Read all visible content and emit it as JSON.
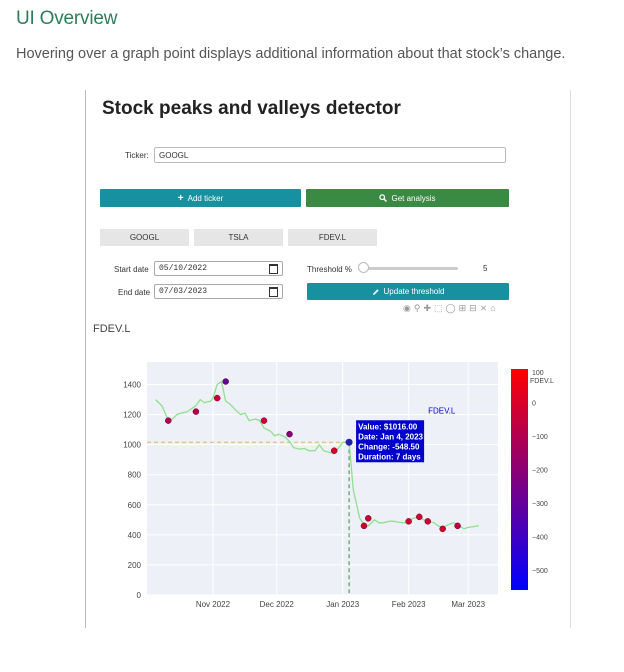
{
  "doc": {
    "title": "UI Overview",
    "description": "Hovering over a graph point displays additional information about that stock’s change."
  },
  "app": {
    "title": "Stock peaks and valleys detector",
    "ticker_label": "Ticker:",
    "ticker_value": "GOOGL",
    "add_ticker_label": "Add ticker",
    "get_analysis_label": "Get analysis",
    "tabs": [
      "GOOGL",
      "TSLA",
      "FDEV.L"
    ],
    "start_date_label": "Start date",
    "start_date_value": "05/10/2022",
    "end_date_label": "End date",
    "end_date_value": "07/03/2023",
    "threshold_label": "Threshold %",
    "threshold_value": "5",
    "threshold_fraction": 0.0,
    "update_threshold_label": "Update threshold",
    "icons": {
      "add": "plus-icon",
      "search": "search-icon",
      "pencil": "pencil-icon",
      "calendar": "calendar-icon",
      "modebar": [
        "camera-icon",
        "zoom-icon",
        "pan-icon",
        "box-select-icon",
        "lasso-icon",
        "zoom-in-icon",
        "zoom-out-icon",
        "autoscale-icon",
        "home-icon"
      ]
    },
    "colors": {
      "teal": "#17919f",
      "green": "#3a8a43",
      "line": "#8fe08f",
      "threshold": "#e0b070"
    }
  },
  "chart_data": {
    "type": "line",
    "title": "FDEV.L",
    "series": [
      {
        "name": "FDEV.L",
        "x": [
          "2022-10-05",
          "2022-10-08",
          "2022-10-11",
          "2022-10-13",
          "2022-10-15",
          "2022-10-17",
          "2022-10-20",
          "2022-10-24",
          "2022-10-26",
          "2022-10-28",
          "2022-10-31",
          "2022-11-01",
          "2022-11-03",
          "2022-11-05",
          "2022-11-07",
          "2022-11-09",
          "2022-11-11",
          "2022-11-14",
          "2022-11-16",
          "2022-11-18",
          "2022-11-21",
          "2022-11-23",
          "2022-11-25",
          "2022-11-28",
          "2022-11-30",
          "2022-12-02",
          "2022-12-05",
          "2022-12-07",
          "2022-12-09",
          "2022-12-12",
          "2022-12-14",
          "2022-12-16",
          "2022-12-19",
          "2022-12-21",
          "2022-12-23",
          "2022-12-28",
          "2023-01-01",
          "2023-01-04",
          "2023-01-06",
          "2023-01-09",
          "2023-01-11",
          "2023-01-13",
          "2023-01-16",
          "2023-01-18",
          "2023-01-20",
          "2023-01-23",
          "2023-01-25",
          "2023-01-27",
          "2023-01-30",
          "2023-02-01",
          "2023-02-03",
          "2023-02-06",
          "2023-02-08",
          "2023-02-10",
          "2023-02-13",
          "2023-02-15",
          "2023-02-17",
          "2023-02-20",
          "2023-02-22",
          "2023-02-24",
          "2023-02-27",
          "2023-03-01",
          "2023-03-06"
        ],
        "y": [
          1300,
          1260,
          1160,
          1170,
          1200,
          1210,
          1220,
          1260,
          1300,
          1280,
          1290,
          1310,
          1400,
          1420,
          1290,
          1270,
          1240,
          1200,
          1210,
          1160,
          1170,
          1160,
          1110,
          1090,
          1060,
          1070,
          1050,
          1020,
          980,
          970,
          975,
          960,
          960,
          1000,
          960,
          940,
          1016,
          1016,
          700,
          510,
          470,
          460,
          500,
          480,
          480,
          490,
          490,
          485,
          480,
          490,
          510,
          520,
          500,
          490,
          480,
          460,
          450,
          470,
          480,
          470,
          440,
          450,
          460
        ]
      }
    ],
    "markers": [
      {
        "x": "2022-10-11",
        "y": 1160,
        "change": -100
      },
      {
        "x": "2022-10-24",
        "y": 1220,
        "change": -80
      },
      {
        "x": "2022-11-03",
        "y": 1310,
        "change": -30
      },
      {
        "x": "2022-11-07",
        "y": 1420,
        "change": -300
      },
      {
        "x": "2022-11-25",
        "y": 1160,
        "change": -30
      },
      {
        "x": "2022-12-07",
        "y": 1070,
        "change": -210
      },
      {
        "x": "2022-12-28",
        "y": 960,
        "change": -5
      },
      {
        "x": "2023-01-04",
        "y": 1016,
        "change": -548.5
      },
      {
        "x": "2023-01-11",
        "y": 460,
        "change": -20
      },
      {
        "x": "2023-01-13",
        "y": 510,
        "change": -30
      },
      {
        "x": "2023-02-01",
        "y": 490,
        "change": 0
      },
      {
        "x": "2023-02-06",
        "y": 520,
        "change": -15
      },
      {
        "x": "2023-02-10",
        "y": 490,
        "change": -25
      },
      {
        "x": "2023-02-17",
        "y": 440,
        "change": -10
      },
      {
        "x": "2023-02-24",
        "y": 460,
        "change": -50
      }
    ],
    "hover": {
      "x": "2023-01-04",
      "y": 1016,
      "lines": [
        "Value: $1016.00",
        "Date: Jan 4, 2023",
        "Change: -548.50",
        "Duration: 7 days"
      ],
      "label": "FDEV.L"
    },
    "threshold_y": 1016,
    "xlim": [
      "2022-10-01",
      "2023-03-15"
    ],
    "ylim": [
      0,
      1550
    ],
    "yticks": [
      0,
      200,
      400,
      600,
      800,
      1000,
      1200,
      1400
    ],
    "xticks": [
      {
        "date": "2022-11-01",
        "label": "Nov 2022"
      },
      {
        "date": "2022-12-01",
        "label": "Dec 2022"
      },
      {
        "date": "2023-01-01",
        "label": "Jan 2023"
      },
      {
        "date": "2023-02-01",
        "label": "Feb 2023"
      },
      {
        "date": "2023-03-01",
        "label": "Mar 2023"
      }
    ],
    "colorbar": {
      "title": "FDEV.L",
      "range": [
        -560,
        100
      ],
      "ticks": [
        100,
        0,
        -100,
        -200,
        -300,
        -400,
        -500
      ],
      "colors": [
        "#ff0000",
        "#0000ff"
      ]
    },
    "grid": true
  }
}
